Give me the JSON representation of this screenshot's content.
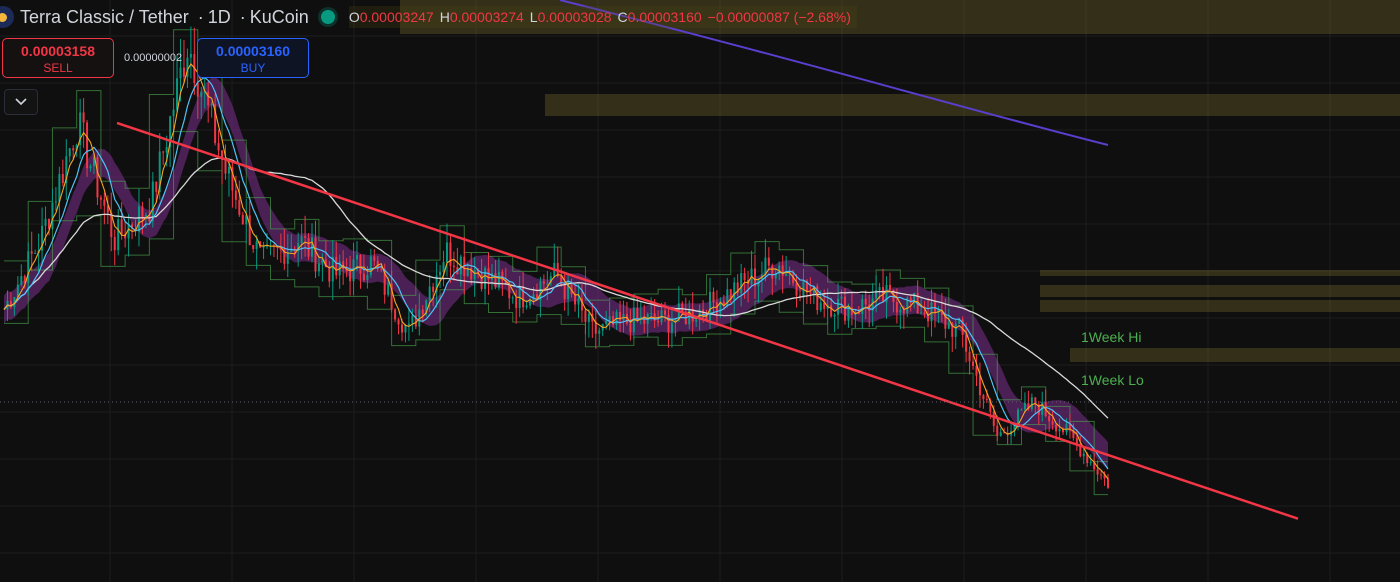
{
  "header": {
    "symbol": "Terra Classic / Tether",
    "interval": "1D",
    "exchange": "KuCoin",
    "separator": "·",
    "open_label": "O",
    "open": "0.00003247",
    "high_label": "H",
    "high": "0.00003274",
    "low_label": "L",
    "low": "0.00003028",
    "close_label": "C",
    "close": "0.00003160",
    "change": "−0.00000087 (−2.68%)"
  },
  "trade": {
    "sell_price": "0.00003158",
    "sell_label": "SELL",
    "spread": "0.00000002",
    "buy_price": "0.00003160",
    "buy_label": "BUY"
  },
  "labels": {
    "week_hi": "1Week Hi",
    "week_lo": "1Week Lo"
  },
  "icons": {
    "logo": "terra-classic-logo-icon",
    "status": "market-status-dot-icon",
    "collapse": "chevron-down-icon"
  },
  "colors": {
    "background": "#0f0f0f",
    "up": "#089981",
    "down": "#f23645",
    "trendline": "#f23645",
    "ma_long": "#d9d9d9",
    "ma_very_long": "#5a3fcf",
    "ma_band": "#7b2f8f",
    "ma_fast": "#f5a623",
    "ma_mid": "#4fc3f7",
    "week_hilo": "#4caf50",
    "zones": "#b8a63a"
  },
  "chart_data": {
    "type": "line",
    "series": [
      {
        "values": [
          3e-05,
          3.6e-05,
          4.6e-05,
          3.6e-05,
          3.9e-05,
          5.3e-05,
          4.2e-05,
          3.4e-05,
          3.6e-05,
          3.3e-05,
          3.4e-05,
          2.8e-05,
          3.5e-05,
          3.3e-05,
          3.1e-05,
          3.3e-05,
          2.8e-05,
          2.9e-05,
          2.9e-05,
          3e-05,
          3.2e-05,
          3.4e-05,
          3.1e-05,
          3e-05,
          3.1e-05,
          3e-05,
          2.8e-05,
          1.9e-05,
          2.2e-05,
          1.9e-05,
          1.5e-05
        ]
      }
    ],
    "trendline": {
      "from": 4.6e-05,
      "to": 1.2e-05
    }
  }
}
